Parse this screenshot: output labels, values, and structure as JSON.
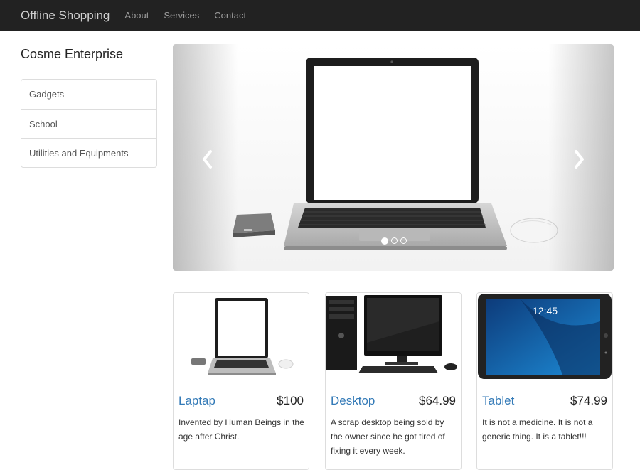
{
  "navbar": {
    "brand": "Offline Shopping",
    "links": [
      "About",
      "Services",
      "Contact"
    ]
  },
  "sidebar": {
    "title": "Cosme Enterprise",
    "categories": [
      "Gadgets",
      "School",
      "Utilities and Equipments"
    ]
  },
  "carousel": {
    "prev_icon": "chevron-left-icon",
    "next_icon": "chevron-right-icon",
    "slide_count": 3,
    "active_index": 0
  },
  "products": [
    {
      "name": "Laptap",
      "price": "$100",
      "description": "Invented by Human Beings in the age after Christ."
    },
    {
      "name": "Desktop",
      "price": "$64.99",
      "description": "A scrap desktop being sold by the owner since he got tired of fixing it every week."
    },
    {
      "name": "Tablet",
      "price": "$74.99",
      "description": "It is not a medicine. It is not a generic thing. It is a tablet!!!"
    }
  ],
  "colors": {
    "navbar_bg": "#222222",
    "link_blue": "#337ab7",
    "border": "#dddddd"
  }
}
